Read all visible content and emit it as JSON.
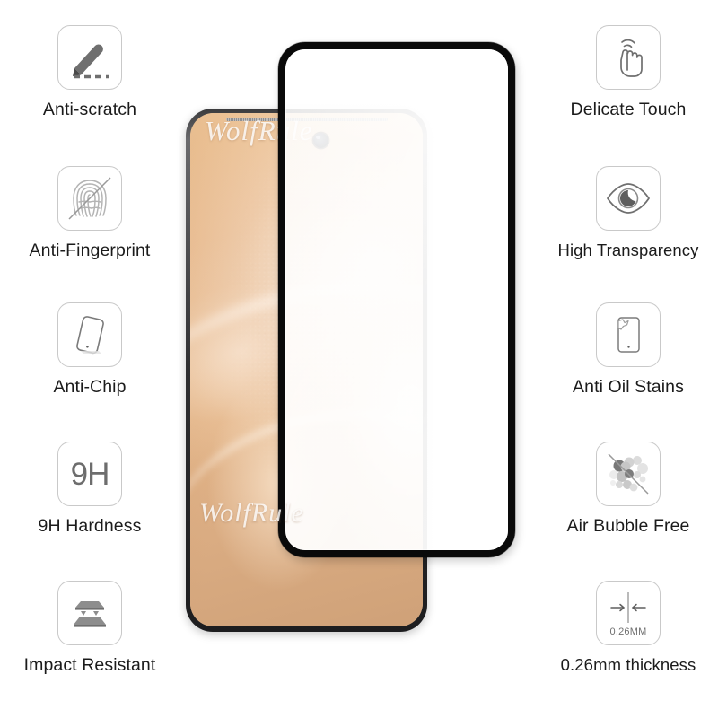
{
  "product": {
    "watermark": "WolfRule",
    "watermark_secondary": "WolfRule"
  },
  "colors": {
    "icon_border": "#c9c9c9",
    "icon_glyph": "#6d6d6d",
    "label_text": "#1b1b1b",
    "glass_border": "#0a0a0a",
    "phone_frame": "#2f2f31",
    "wallpaper_warm": "#eec091"
  },
  "features_left": [
    {
      "id": "anti-scratch",
      "label": "Anti-scratch",
      "icon": "pen-scratch-icon"
    },
    {
      "id": "anti-fingerprint",
      "label": "Anti-Fingerprint",
      "icon": "fingerprint-slash-icon"
    },
    {
      "id": "anti-chip",
      "label": "Anti-Chip",
      "icon": "tilted-phone-icon"
    },
    {
      "id": "9h-hardness",
      "label": "9H Hardness",
      "icon": "9h-text-icon",
      "glyph": "9H"
    },
    {
      "id": "impact-resistant",
      "label": "Impact Resistant",
      "icon": "layered-plates-icon"
    }
  ],
  "features_right": [
    {
      "id": "delicate-touch",
      "label": "Delicate Touch",
      "icon": "hand-tap-icon"
    },
    {
      "id": "high-transparency",
      "label": "High Transparency",
      "icon": "eye-icon"
    },
    {
      "id": "anti-oil-stains",
      "label": "Anti Oil Stains",
      "icon": "phone-stain-icon"
    },
    {
      "id": "air-bubble-free",
      "label": "Air Bubble Free",
      "icon": "bubbles-slash-icon"
    },
    {
      "id": "thickness",
      "label": "0.26mm thickness",
      "icon": "thickness-arrows-icon",
      "caption": "0.26MM"
    }
  ]
}
